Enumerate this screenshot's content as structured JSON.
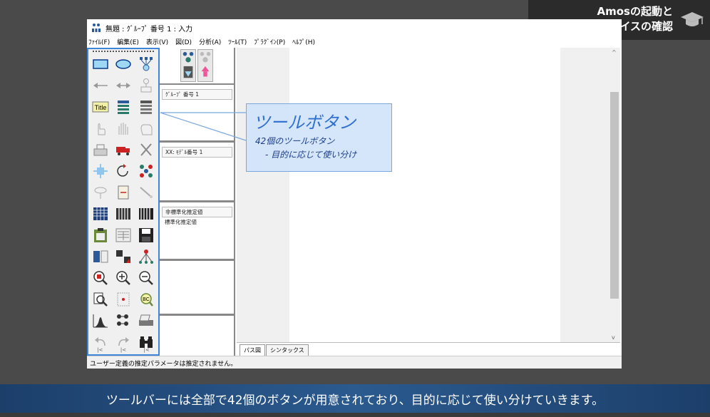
{
  "title_tag": {
    "line1": "Amosの起動と",
    "line2": "インターフェイスの確認"
  },
  "window": {
    "title": "無題 : ｸﾞﾙｰﾌﾟ 番号 1 : 入力",
    "menus": [
      "ﾌｧｲﾙ(F)",
      "編集(E)",
      "表示(V)",
      "図(D)",
      "分析(A)",
      "ﾂｰﾙ(T)",
      "ﾌﾟﾗｸﾞｲﾝ(P)",
      "ﾍﾙﾌﾟ(H)"
    ],
    "mid_sections": {
      "group": "ｸﾞﾙｰﾌﾟ 番号 1",
      "model": "XX: ﾓﾃﾞﾙ番号 1",
      "estimate_header": "非標準化推定値",
      "estimate_line": "標準化推定値"
    },
    "tabs": [
      "パス図",
      "シンタックス"
    ],
    "status": "ユーザー定義の推定パラメータは推定されません。"
  },
  "callout": {
    "heading": "ツールボタン",
    "line1": "42個のツールボタン",
    "line2": "- 目的に応じて使い分け"
  },
  "subtitle": "ツールバーには全部で42個のボタンが用意されており、目的に応じて使い分けていきます。",
  "colors": {
    "highlight_border": "#3d86d8",
    "callout_text": "#2f6fd0",
    "band": "#2b5a8f"
  }
}
